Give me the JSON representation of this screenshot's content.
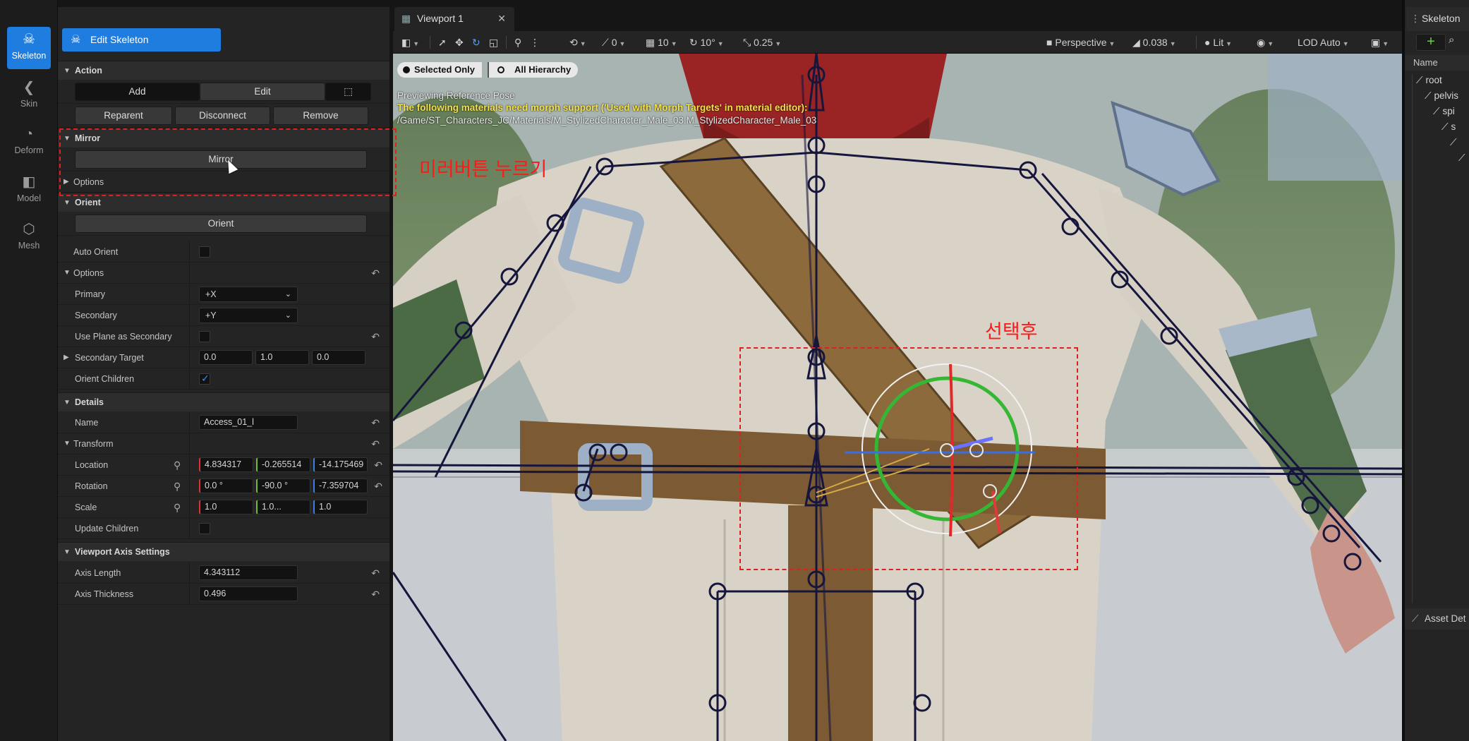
{
  "modebar": {
    "items": [
      {
        "label": "Skeleton",
        "icon": "skeleton-icon",
        "glyph": "☠",
        "active": true
      },
      {
        "label": "Skin",
        "icon": "skin-icon",
        "glyph": "❮"
      },
      {
        "label": "Deform",
        "icon": "deform-icon",
        "glyph": "◔"
      },
      {
        "label": "Model",
        "icon": "model-icon",
        "glyph": "◧"
      },
      {
        "label": "Mesh",
        "icon": "mesh-icon",
        "glyph": "⬡"
      }
    ]
  },
  "panel": {
    "mode_button": "Edit Skeleton",
    "action": {
      "title": "Action",
      "add": "Add",
      "edit": "Edit",
      "reparent": "Reparent",
      "disconnect": "Disconnect",
      "remove": "Remove"
    },
    "mirror": {
      "title": "Mirror",
      "button": "Mirror",
      "options": "Options"
    },
    "orient": {
      "title": "Orient",
      "button": "Orient",
      "auto_orient": "Auto Orient",
      "options": "Options",
      "primary_label": "Primary",
      "primary_value": "+X",
      "secondary_label": "Secondary",
      "secondary_value": "+Y",
      "use_plane_label": "Use Plane as Secondary",
      "secondary_target_label": "Secondary Target",
      "secondary_target": [
        "0.0",
        "1.0",
        "0.0"
      ],
      "orient_children_label": "Orient Children",
      "orient_children": true
    },
    "details": {
      "title": "Details",
      "name_label": "Name",
      "name_value": "Access_01_l",
      "transform": "Transform",
      "location_label": "Location",
      "location": [
        "4.834317",
        "-0.265514",
        "-14.175469"
      ],
      "rotation_label": "Rotation",
      "rotation": [
        "0.0 °",
        "-90.0 °",
        "-7.359704"
      ],
      "scale_label": "Scale",
      "scale": [
        "1.0",
        "1.0...",
        "1.0"
      ],
      "update_children_label": "Update Children"
    },
    "viewport_axis": {
      "title": "Viewport Axis Settings",
      "axis_length_label": "Axis Length",
      "axis_length": "4.343112",
      "axis_thickness_label": "Axis Thickness",
      "axis_thickness": "0.496"
    }
  },
  "viewport": {
    "tab": "Viewport 1",
    "toolbar": {
      "grid_value": "0",
      "move_snap": "10",
      "rot_snap": "10°",
      "scale_snap": "0.25",
      "perspective": "Perspective",
      "fov": "0.038",
      "lit": "Lit",
      "lod": "LOD Auto"
    },
    "selected_only": "Selected Only",
    "all_hierarchy": "All Hierarchy",
    "msg_preview": "Previewing Reference Pose",
    "msg_warning": "The following materials need morph support ('Used with Morph Targets' in material editor):",
    "msg_path": "/Game/ST_Characters_JC/Materials/M_StylizedCharacter_Male_03.M_StylizedCharacter_Male_03"
  },
  "rpanel": {
    "tab": "Skeleton",
    "column_name": "Name",
    "tree": [
      "root",
      "pelvis",
      "spi",
      "s",
      "",
      ""
    ],
    "bottom_tab": "Asset Det"
  },
  "annotations": {
    "mirror_hint": "미러버튼 누르기",
    "select_hint": "선택후"
  },
  "colors": {
    "accent": "#1f7de0",
    "annotation": "#e02020",
    "gizmo_green": "#3ec43e",
    "bone": "#15153a"
  }
}
